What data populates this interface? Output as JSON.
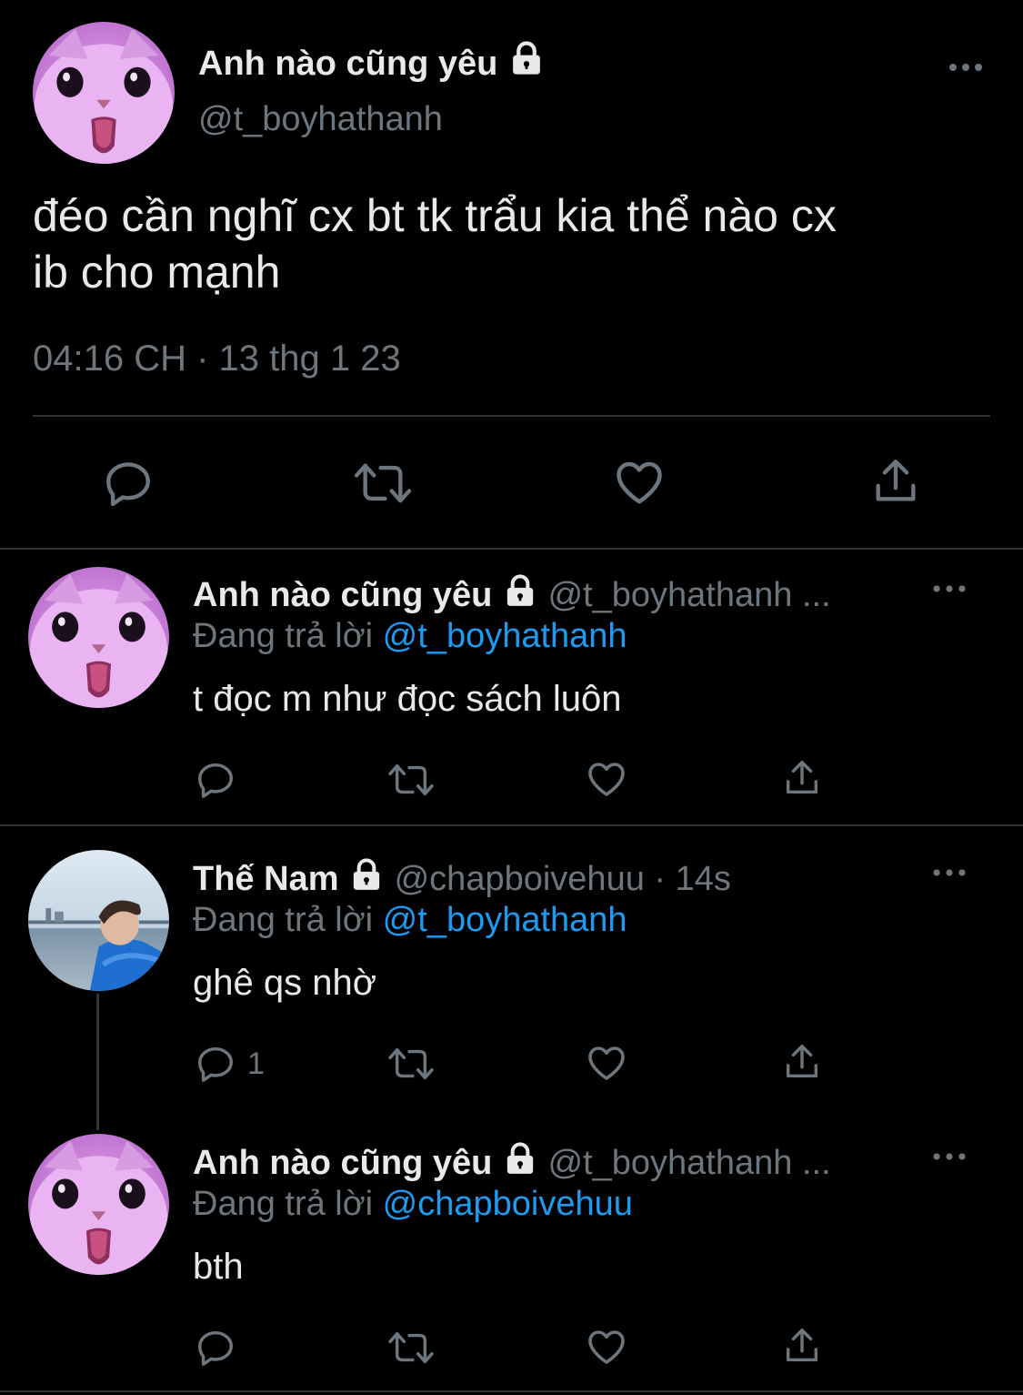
{
  "main_tweet": {
    "display_name": "Anh nào cũng yêu",
    "handle": "@t_boyhathanh",
    "text_line1": "đéo cần nghĩ cx bt tk trẩu kia thể nào cx",
    "text_line2": "ib cho mạnh",
    "timestamp": "04:16 CH · 13 thg 1 23"
  },
  "replies": [
    {
      "display_name": "Anh nào cũng yêu",
      "handle": "@t_boyhathanh ...",
      "replying_label": "Đang trả lời",
      "replying_to": "@t_boyhathanh",
      "text": "t đọc m như đọc sách luôn",
      "reply_count": ""
    },
    {
      "display_name": "Thế Nam",
      "handle": "@chapboivehuu · 14s",
      "replying_label": "Đang trả lời",
      "replying_to": "@t_boyhathanh",
      "text": "ghê qs nhờ",
      "reply_count": "1"
    },
    {
      "display_name": "Anh nào cũng yêu",
      "handle": "@t_boyhathanh ...",
      "replying_label": "Đang trả lời",
      "replying_to": "@chapboivehuu",
      "text": "bth",
      "reply_count": ""
    }
  ],
  "icons": {
    "reply": "reply-icon",
    "retweet": "retweet-icon",
    "like": "like-icon",
    "share": "share-icon",
    "more": "more-icon",
    "lock": "lock-icon"
  },
  "colors": {
    "background": "#000000",
    "text": "#e7e9ea",
    "muted": "#6e767d",
    "link": "#1d9bf0",
    "divider": "#2f3336"
  }
}
